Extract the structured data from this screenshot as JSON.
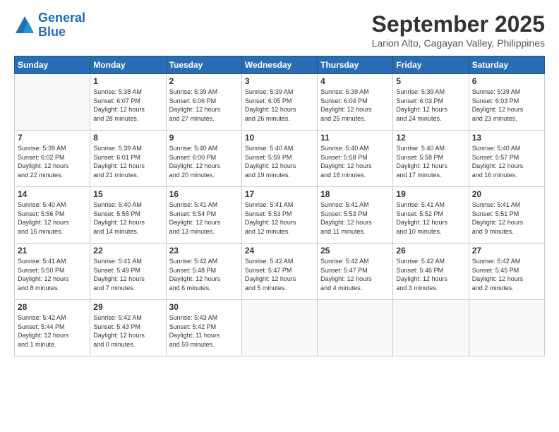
{
  "logo": {
    "line1": "General",
    "line2": "Blue"
  },
  "title": "September 2025",
  "location": "Larion Alto, Cagayan Valley, Philippines",
  "days_of_week": [
    "Sunday",
    "Monday",
    "Tuesday",
    "Wednesday",
    "Thursday",
    "Friday",
    "Saturday"
  ],
  "weeks": [
    [
      {
        "day": "",
        "info": ""
      },
      {
        "day": "1",
        "info": "Sunrise: 5:38 AM\nSunset: 6:07 PM\nDaylight: 12 hours\nand 28 minutes."
      },
      {
        "day": "2",
        "info": "Sunrise: 5:39 AM\nSunset: 6:06 PM\nDaylight: 12 hours\nand 27 minutes."
      },
      {
        "day": "3",
        "info": "Sunrise: 5:39 AM\nSunset: 6:05 PM\nDaylight: 12 hours\nand 26 minutes."
      },
      {
        "day": "4",
        "info": "Sunrise: 5:39 AM\nSunset: 6:04 PM\nDaylight: 12 hours\nand 25 minutes."
      },
      {
        "day": "5",
        "info": "Sunrise: 5:39 AM\nSunset: 6:03 PM\nDaylight: 12 hours\nand 24 minutes."
      },
      {
        "day": "6",
        "info": "Sunrise: 5:39 AM\nSunset: 6:03 PM\nDaylight: 12 hours\nand 23 minutes."
      }
    ],
    [
      {
        "day": "7",
        "info": "Sunrise: 5:39 AM\nSunset: 6:02 PM\nDaylight: 12 hours\nand 22 minutes."
      },
      {
        "day": "8",
        "info": "Sunrise: 5:39 AM\nSunset: 6:01 PM\nDaylight: 12 hours\nand 21 minutes."
      },
      {
        "day": "9",
        "info": "Sunrise: 5:40 AM\nSunset: 6:00 PM\nDaylight: 12 hours\nand 20 minutes."
      },
      {
        "day": "10",
        "info": "Sunrise: 5:40 AM\nSunset: 5:59 PM\nDaylight: 12 hours\nand 19 minutes."
      },
      {
        "day": "11",
        "info": "Sunrise: 5:40 AM\nSunset: 5:58 PM\nDaylight: 12 hours\nand 18 minutes."
      },
      {
        "day": "12",
        "info": "Sunrise: 5:40 AM\nSunset: 5:58 PM\nDaylight: 12 hours\nand 17 minutes."
      },
      {
        "day": "13",
        "info": "Sunrise: 5:40 AM\nSunset: 5:57 PM\nDaylight: 12 hours\nand 16 minutes."
      }
    ],
    [
      {
        "day": "14",
        "info": "Sunrise: 5:40 AM\nSunset: 5:56 PM\nDaylight: 12 hours\nand 15 minutes."
      },
      {
        "day": "15",
        "info": "Sunrise: 5:40 AM\nSunset: 5:55 PM\nDaylight: 12 hours\nand 14 minutes."
      },
      {
        "day": "16",
        "info": "Sunrise: 5:41 AM\nSunset: 5:54 PM\nDaylight: 12 hours\nand 13 minutes."
      },
      {
        "day": "17",
        "info": "Sunrise: 5:41 AM\nSunset: 5:53 PM\nDaylight: 12 hours\nand 12 minutes."
      },
      {
        "day": "18",
        "info": "Sunrise: 5:41 AM\nSunset: 5:53 PM\nDaylight: 12 hours\nand 11 minutes."
      },
      {
        "day": "19",
        "info": "Sunrise: 5:41 AM\nSunset: 5:52 PM\nDaylight: 12 hours\nand 10 minutes."
      },
      {
        "day": "20",
        "info": "Sunrise: 5:41 AM\nSunset: 5:51 PM\nDaylight: 12 hours\nand 9 minutes."
      }
    ],
    [
      {
        "day": "21",
        "info": "Sunrise: 5:41 AM\nSunset: 5:50 PM\nDaylight: 12 hours\nand 8 minutes."
      },
      {
        "day": "22",
        "info": "Sunrise: 5:41 AM\nSunset: 5:49 PM\nDaylight: 12 hours\nand 7 minutes."
      },
      {
        "day": "23",
        "info": "Sunrise: 5:42 AM\nSunset: 5:48 PM\nDaylight: 12 hours\nand 6 minutes."
      },
      {
        "day": "24",
        "info": "Sunrise: 5:42 AM\nSunset: 5:47 PM\nDaylight: 12 hours\nand 5 minutes."
      },
      {
        "day": "25",
        "info": "Sunrise: 5:42 AM\nSunset: 5:47 PM\nDaylight: 12 hours\nand 4 minutes."
      },
      {
        "day": "26",
        "info": "Sunrise: 5:42 AM\nSunset: 5:46 PM\nDaylight: 12 hours\nand 3 minutes."
      },
      {
        "day": "27",
        "info": "Sunrise: 5:42 AM\nSunset: 5:45 PM\nDaylight: 12 hours\nand 2 minutes."
      }
    ],
    [
      {
        "day": "28",
        "info": "Sunrise: 5:42 AM\nSunset: 5:44 PM\nDaylight: 12 hours\nand 1 minute."
      },
      {
        "day": "29",
        "info": "Sunrise: 5:42 AM\nSunset: 5:43 PM\nDaylight: 12 hours\nand 0 minutes."
      },
      {
        "day": "30",
        "info": "Sunrise: 5:43 AM\nSunset: 5:42 PM\nDaylight: 11 hours\nand 59 minutes."
      },
      {
        "day": "",
        "info": ""
      },
      {
        "day": "",
        "info": ""
      },
      {
        "day": "",
        "info": ""
      },
      {
        "day": "",
        "info": ""
      }
    ]
  ]
}
